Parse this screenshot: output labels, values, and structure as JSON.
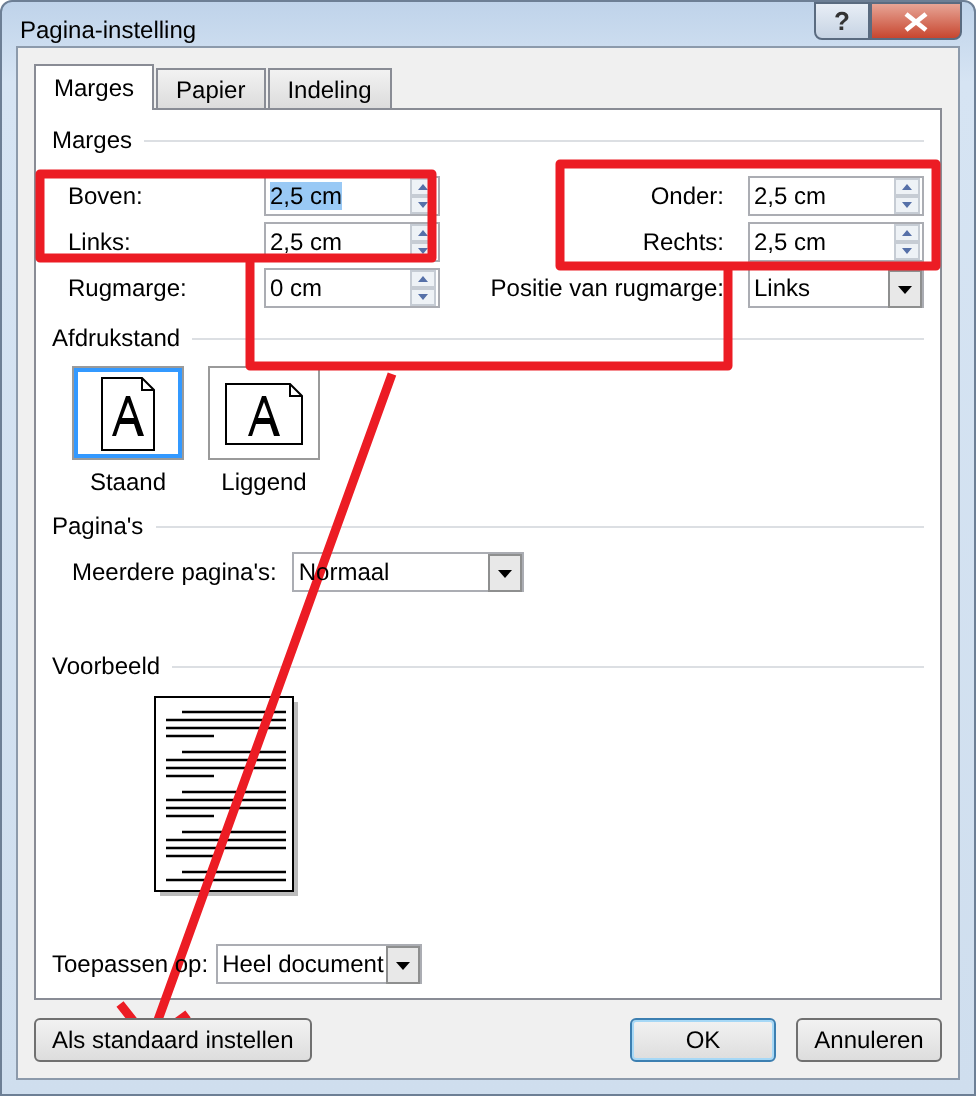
{
  "window": {
    "title": "Pagina-instelling"
  },
  "title_buttons": [
    {
      "kind": "help",
      "label": "?"
    },
    {
      "kind": "close"
    }
  ],
  "tabs": [
    {
      "label": "Marges",
      "selected": true
    },
    {
      "label": "Papier",
      "selected": false
    },
    {
      "label": "Indeling",
      "selected": false
    }
  ],
  "margins": {
    "heading": "Marges",
    "left_fields": [
      {
        "label": "Boven:",
        "value": "2,5 cm",
        "highlighted": true
      },
      {
        "label": "Links:",
        "value": "2,5 cm",
        "highlighted": false
      },
      {
        "label": "Rugmarge:",
        "value": "0 cm",
        "highlighted": false
      }
    ],
    "right_fields": [
      {
        "label": "Onder:",
        "kind": "spin",
        "value": "2,5 cm"
      },
      {
        "label": "Rechts:",
        "kind": "spin",
        "value": "2,5 cm"
      },
      {
        "label": "Positie van rugmarge:",
        "kind": "dropdown",
        "value": "Links"
      }
    ]
  },
  "orientation": {
    "heading": "Afdrukstand",
    "options": [
      {
        "label": "Staand",
        "kind": "portrait",
        "selected": true
      },
      {
        "label": "Liggend",
        "kind": "landscape",
        "selected": false
      }
    ]
  },
  "pages": {
    "heading": "Pagina's",
    "label": "Meerdere pagina's:",
    "value": "Normaal"
  },
  "preview": {
    "heading": "Voorbeeld"
  },
  "apply": {
    "label": "Toepassen op:",
    "value": "Heel document"
  },
  "buttons": [
    {
      "label": "Als standaard instellen",
      "kind": "left",
      "default": false
    },
    {
      "label": "OK",
      "kind": "right",
      "default": true
    },
    {
      "label": "Annuleren",
      "kind": "right",
      "default": false
    }
  ],
  "annotations": [
    {
      "kind": "box"
    },
    {
      "kind": "box"
    },
    {
      "kind": "bracket"
    },
    {
      "kind": "arrow"
    }
  ]
}
